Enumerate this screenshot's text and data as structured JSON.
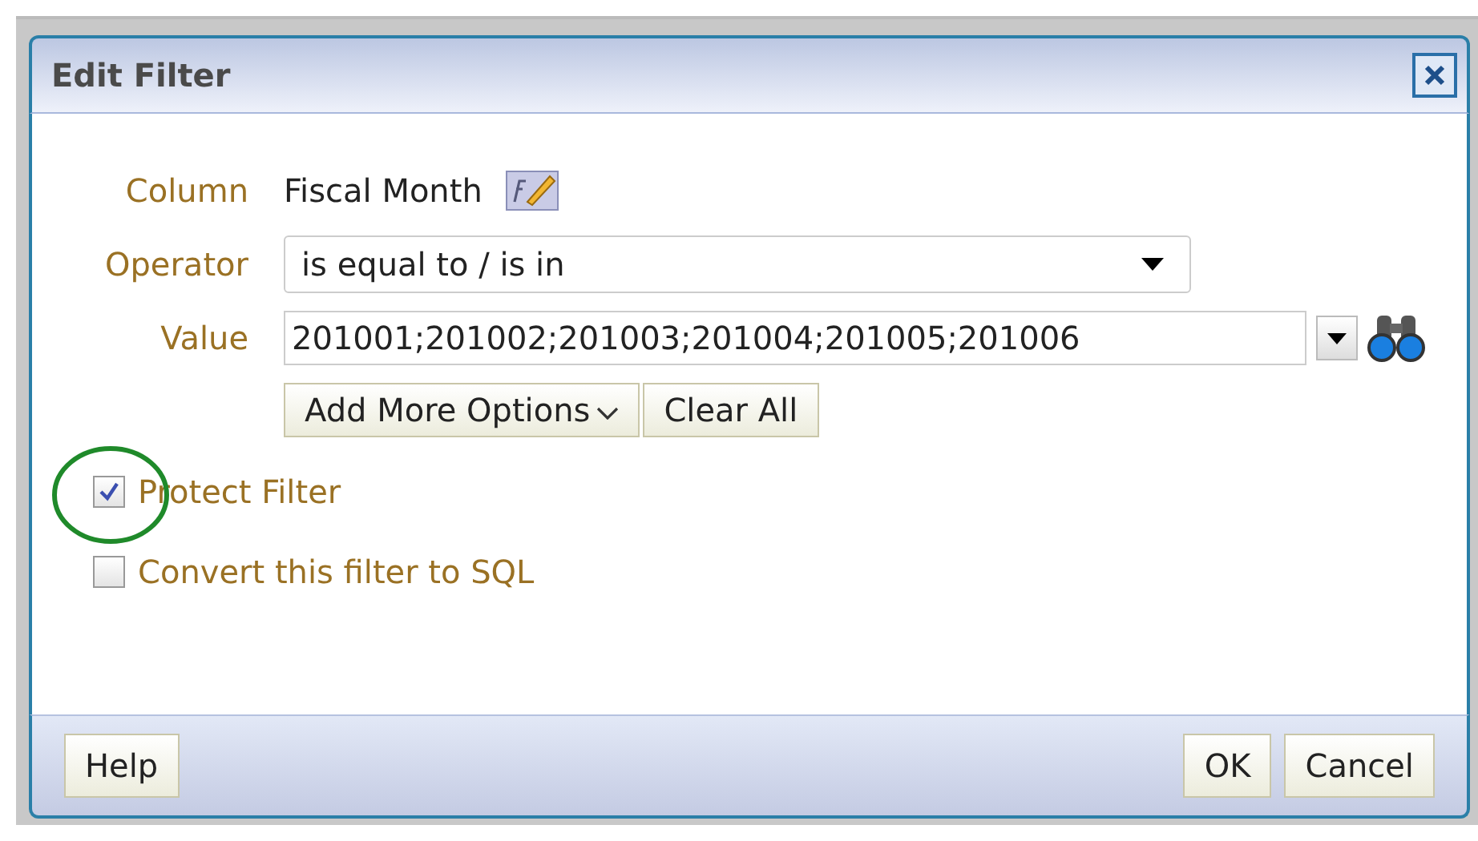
{
  "window": {
    "title": "Edit Filter"
  },
  "fields": [
    {
      "kind": "text",
      "label": "Column",
      "value": "Fiscal Month"
    },
    {
      "kind": "select",
      "label": "Operator",
      "value": "is equal to / is in"
    },
    {
      "kind": "input",
      "label": "Value",
      "value": "201001;201002;201003;201004;201005;201006"
    }
  ],
  "value_buttons": [
    {
      "label": "Add More Options",
      "kind": "menu"
    },
    {
      "label": "Clear All",
      "kind": "plain"
    }
  ],
  "options": [
    {
      "label": "Protect Filter",
      "checked": true,
      "highlighted": true
    },
    {
      "label": "Convert this filter to SQL",
      "checked": false,
      "highlighted": false
    }
  ],
  "footer": {
    "left_buttons": [
      "Help"
    ],
    "right_buttons": [
      "OK",
      "Cancel"
    ]
  }
}
